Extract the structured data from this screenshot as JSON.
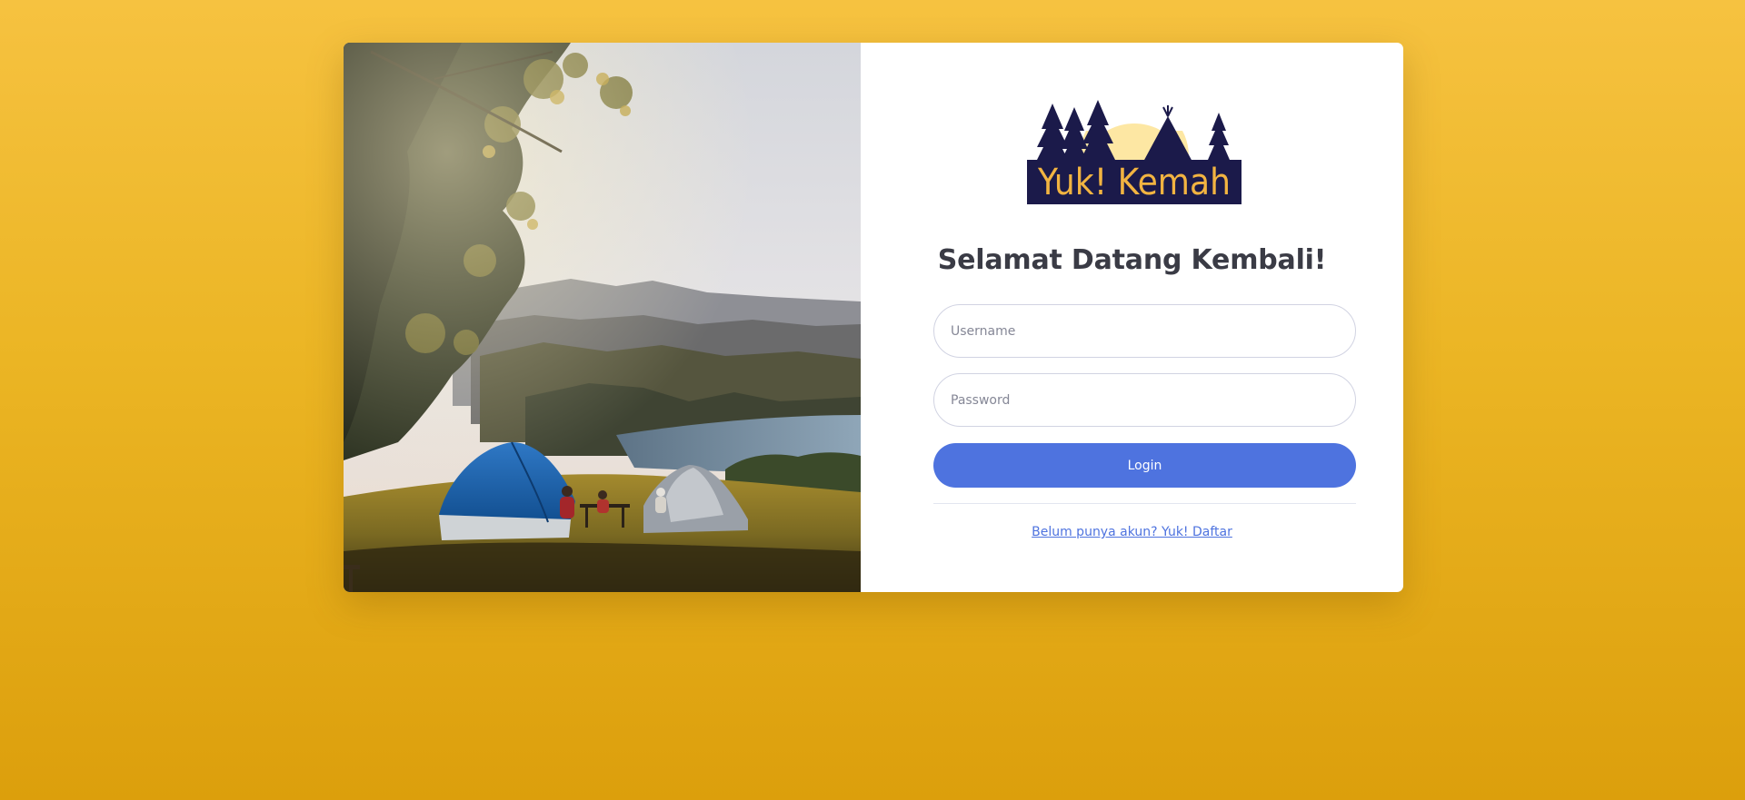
{
  "brand": {
    "logo_text": "Yuk! Kemah",
    "colors": {
      "navy": "#1b1a4a",
      "gold": "#f2b441",
      "sun": "#fde7a3"
    }
  },
  "login": {
    "title": "Selamat Datang Kembali!",
    "username_placeholder": "Username",
    "password_placeholder": "Password",
    "login_label": "Login",
    "register_link": "Belum punya akun? Yuk! Daftar"
  },
  "theme": {
    "background_top": "#f6c240",
    "background_bottom": "#dc9f0c",
    "primary": "#4e73df",
    "text_dark": "#3a3b45"
  },
  "hero_image": {
    "subject": "camping-tents-on-hill-over-lake"
  }
}
